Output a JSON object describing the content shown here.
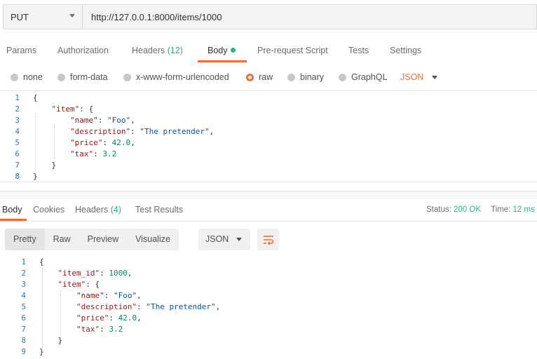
{
  "request": {
    "method": "PUT",
    "url": "http://127.0.0.1:8000/items/1000"
  },
  "request_tabs": [
    {
      "label": "Params"
    },
    {
      "label": "Authorization"
    },
    {
      "label": "Headers",
      "count": "(12)"
    },
    {
      "label": "Body",
      "active": true,
      "indicator": "green-dot"
    },
    {
      "label": "Pre-request Script"
    },
    {
      "label": "Tests"
    },
    {
      "label": "Settings"
    }
  ],
  "body_types": [
    {
      "label": "none",
      "selected": false
    },
    {
      "label": "form-data",
      "selected": false
    },
    {
      "label": "x-www-form-urlencoded",
      "selected": false
    },
    {
      "label": "raw",
      "selected": true
    },
    {
      "label": "binary",
      "selected": false
    },
    {
      "label": "GraphQL",
      "selected": false
    }
  ],
  "raw_format": "JSON",
  "request_body_lines": [
    "{",
    "    \"item\": {",
    "        \"name\": \"Foo\",",
    "        \"description\": \"The pretender\",",
    "        \"price\": 42.0,",
    "        \"tax\": 3.2",
    "    }",
    "}"
  ],
  "response_tabs": [
    {
      "label": "Body",
      "active": true
    },
    {
      "label": "Cookies"
    },
    {
      "label": "Headers",
      "count": "(4)"
    },
    {
      "label": "Test Results"
    }
  ],
  "status": {
    "label": "Status:",
    "value": "200 OK"
  },
  "time": {
    "label": "Time:",
    "value": "12 ms"
  },
  "view_modes": [
    "Pretty",
    "Raw",
    "Preview",
    "Visualize"
  ],
  "response_format": "JSON",
  "wrap_icon": "wrap-lines-icon",
  "response_body_lines": [
    "{",
    "    \"item_id\": 1000,",
    "    \"item\": {",
    "        \"name\": \"Foo\",",
    "        \"description\": \"The pretender\",",
    "        \"price\": 42.0,",
    "        \"tax\": 3.2",
    "    }",
    "}"
  ],
  "colors": {
    "accent": "#f26b3a",
    "success": "#26b47f",
    "line_number": "#2a7ab0",
    "json_key": "#a31515",
    "json_string": "#0451a5",
    "json_number": "#098658"
  }
}
